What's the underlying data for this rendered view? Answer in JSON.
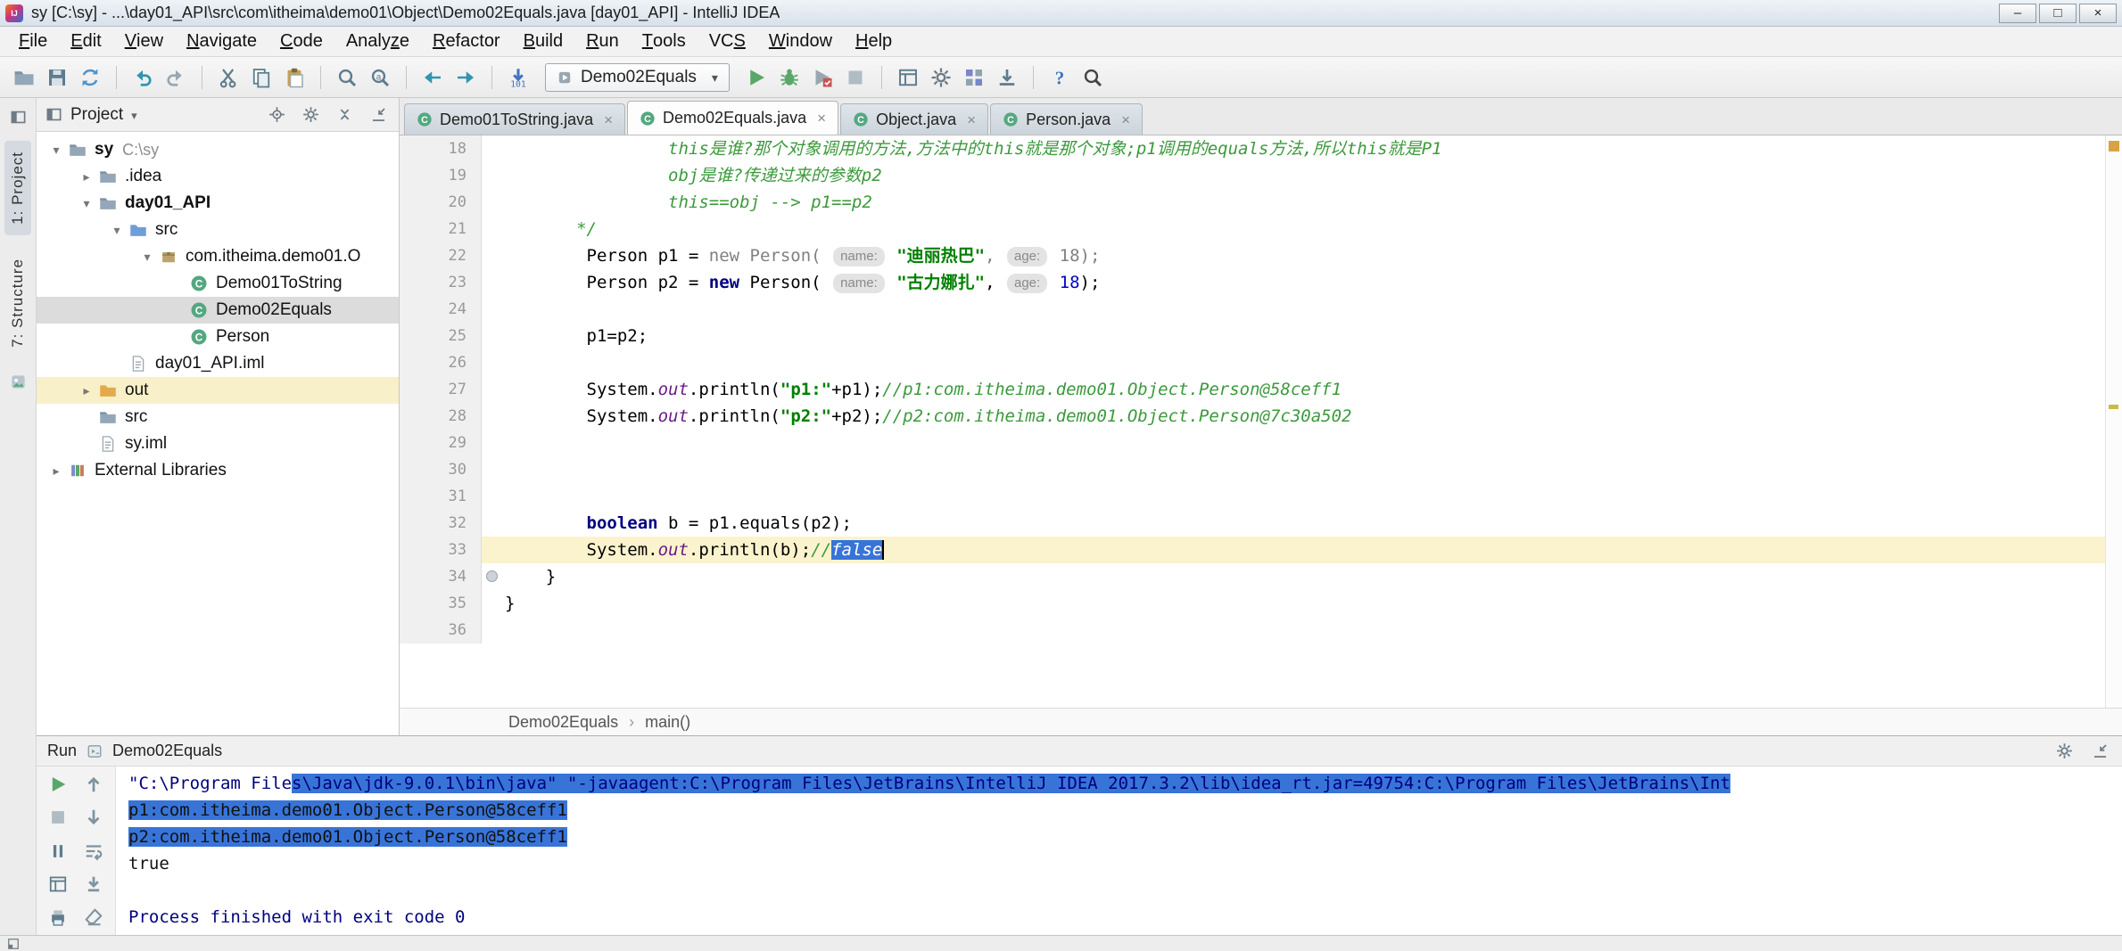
{
  "colors": {
    "sel": "#3874d8",
    "kw": "#000080",
    "str": "#008000",
    "cmt": "#3c9a3c",
    "field": "#6a1b8a",
    "num": "#0000cc",
    "current_line": "#fbf3cd",
    "out_row": "#f8f0c8",
    "run_green": "#59a869",
    "stripe_inspection": "#d9a343",
    "stripe_warning": "#c9b945"
  },
  "window": {
    "logo": "IJ",
    "title": "sy [C:\\sy] - ...\\day01_API\\src\\com\\itheima\\demo01\\Object\\Demo02Equals.java [day01_API] - IntelliJ IDEA",
    "buttons": {
      "minimize": "–",
      "maximize": "□",
      "close": "×"
    }
  },
  "menu_bar": {
    "items": [
      {
        "label": "File",
        "u": 0
      },
      {
        "label": "Edit",
        "u": 0
      },
      {
        "label": "View",
        "u": 0
      },
      {
        "label": "Navigate",
        "u": 0
      },
      {
        "label": "Code",
        "u": 0
      },
      {
        "label": "Analyze",
        "u": 5
      },
      {
        "label": "Refactor",
        "u": 0
      },
      {
        "label": "Build",
        "u": 0
      },
      {
        "label": "Run",
        "u": 0
      },
      {
        "label": "Tools",
        "u": 0
      },
      {
        "label": "VCS",
        "u": 2
      },
      {
        "label": "Window",
        "u": 0
      },
      {
        "label": "Help",
        "u": 0
      }
    ]
  },
  "toolbar": {
    "run_config": "Demo02Equals",
    "items": [
      {
        "icon": "open-folder"
      },
      {
        "icon": "save-all"
      },
      {
        "icon": "synchronize"
      },
      {
        "divider": true
      },
      {
        "icon": "undo"
      },
      {
        "icon": "redo"
      },
      {
        "divider": true
      },
      {
        "icon": "cut"
      },
      {
        "icon": "copy"
      },
      {
        "icon": "paste"
      },
      {
        "divider": true
      },
      {
        "icon": "find"
      },
      {
        "icon": "replace"
      },
      {
        "divider": true
      },
      {
        "icon": "back"
      },
      {
        "icon": "forward"
      },
      {
        "divider": true
      },
      {
        "icon": "update-project"
      },
      {
        "combo": true
      },
      {
        "icon": "run"
      },
      {
        "icon": "debug"
      },
      {
        "icon": "coverage"
      },
      {
        "icon": "stop"
      },
      {
        "divider": true
      },
      {
        "icon": "restore-layout"
      },
      {
        "icon": "settings"
      },
      {
        "icon": "project-structure"
      },
      {
        "icon": "export"
      },
      {
        "divider": true
      },
      {
        "icon": "help"
      },
      {
        "icon": "search-everywhere"
      }
    ]
  },
  "tool_strip": {
    "tabs": [
      {
        "label": "1: Project",
        "active": true
      },
      {
        "label": "7: Structure",
        "active": false
      }
    ]
  },
  "project_panel": {
    "title": "Project",
    "header_icons": [
      "locate",
      "settings",
      "collapse-all",
      "hide-panel"
    ],
    "tree": [
      {
        "label": "sy",
        "suffix": "C:\\sy",
        "icon": "folder",
        "level": 0,
        "chevron": "down",
        "bold": true
      },
      {
        "label": ".idea",
        "icon": "folder",
        "level": 1,
        "chevron": "right"
      },
      {
        "label": "day01_API",
        "icon": "folder",
        "level": 1,
        "chevron": "down",
        "bold": true
      },
      {
        "label": "src",
        "icon": "folder-src",
        "level": 2,
        "chevron": "down"
      },
      {
        "label": "com.itheima.demo01.O",
        "icon": "package",
        "level": 3,
        "chevron": "down"
      },
      {
        "label": "Demo01ToString",
        "icon": "class",
        "level": 4
      },
      {
        "label": "Demo02Equals",
        "icon": "class",
        "level": 4,
        "selected": true
      },
      {
        "label": "Person",
        "icon": "class",
        "level": 4
      },
      {
        "label": "day01_API.iml",
        "icon": "iml",
        "level": 2
      },
      {
        "label": "out",
        "icon": "folder-out",
        "level": 1,
        "chevron": "right",
        "row_highlight": true
      },
      {
        "label": "src",
        "icon": "folder",
        "level": 1
      },
      {
        "label": "sy.iml",
        "icon": "iml",
        "level": 1
      },
      {
        "label": "External Libraries",
        "icon": "library",
        "level": 0,
        "chevron": "right"
      }
    ]
  },
  "editor": {
    "tabs": [
      {
        "label": "Demo01ToString.java",
        "icon": "class"
      },
      {
        "label": "Demo02Equals.java",
        "icon": "class",
        "active": true
      },
      {
        "label": "Object.java",
        "icon": "class"
      },
      {
        "label": "Person.java",
        "icon": "class"
      }
    ],
    "breadcrumbs": [
      "Demo02Equals",
      "main()"
    ],
    "stripe_markers": [
      {
        "name": "inspections-indicator",
        "color": "#d9a343"
      },
      {
        "name": "warning-stripe-mark",
        "color": "#c9b945"
      }
    ],
    "lines": [
      {
        "n": 18,
        "s": [
          [
            "                ",
            "p"
          ],
          [
            "this是谁?那个对象调用的方法,方法中的this就是那个对象;p1调用的equals方法,所以this就是P1",
            "cmt"
          ]
        ]
      },
      {
        "n": 19,
        "s": [
          [
            "                ",
            "p"
          ],
          [
            "obj是谁?传递过来的参数p2",
            "cmt"
          ]
        ]
      },
      {
        "n": 20,
        "s": [
          [
            "                ",
            "p"
          ],
          [
            "this==obj --> p1==p2",
            "cmt"
          ]
        ]
      },
      {
        "n": 21,
        "s": [
          [
            "       ",
            "p"
          ],
          [
            "*/",
            "cmt"
          ]
        ]
      },
      {
        "n": 22,
        "s": [
          [
            "        Person p1 = ",
            "p"
          ],
          [
            "new Person( ",
            "gray"
          ],
          [
            "name:",
            "hint"
          ],
          [
            " ",
            "gray"
          ],
          [
            "\"迪丽热巴\"",
            "str"
          ],
          [
            ", ",
            "gray"
          ],
          [
            "age:",
            "hint"
          ],
          [
            " ",
            "gray"
          ],
          [
            "18",
            "gray"
          ],
          [
            ");",
            "gray"
          ]
        ]
      },
      {
        "n": 23,
        "s": [
          [
            "        Person p2 = ",
            "p"
          ],
          [
            "new",
            "kw"
          ],
          [
            " Person( ",
            "p"
          ],
          [
            "name:",
            "hint"
          ],
          [
            " ",
            "p"
          ],
          [
            "\"古力娜扎\"",
            "str"
          ],
          [
            ", ",
            "p"
          ],
          [
            "age:",
            "hint"
          ],
          [
            " ",
            "p"
          ],
          [
            "18",
            "num"
          ],
          [
            ");",
            "p"
          ]
        ]
      },
      {
        "n": 24,
        "s": []
      },
      {
        "n": 25,
        "s": [
          [
            "        p1=p2;",
            "p"
          ]
        ]
      },
      {
        "n": 26,
        "s": []
      },
      {
        "n": 27,
        "s": [
          [
            "        System.",
            "p"
          ],
          [
            "out",
            "field"
          ],
          [
            ".println(",
            "p"
          ],
          [
            "\"p1:\"",
            "str"
          ],
          [
            "+p1);",
            "p"
          ],
          [
            "//p1:com.itheima.demo01.Object.Person@58ceff1",
            "cmt"
          ]
        ]
      },
      {
        "n": 28,
        "s": [
          [
            "        System.",
            "p"
          ],
          [
            "out",
            "field"
          ],
          [
            ".println(",
            "p"
          ],
          [
            "\"p2:\"",
            "str"
          ],
          [
            "+p2);",
            "p"
          ],
          [
            "//p2:com.itheima.demo01.Object.Person@7c30a502",
            "cmt"
          ]
        ]
      },
      {
        "n": 29,
        "s": []
      },
      {
        "n": 30,
        "s": []
      },
      {
        "n": 31,
        "s": []
      },
      {
        "n": 32,
        "s": [
          [
            "        ",
            "p"
          ],
          [
            "boolean",
            "kw"
          ],
          [
            " b = p1.equals(p2);",
            "p"
          ]
        ]
      },
      {
        "n": 33,
        "cur": true,
        "s": [
          [
            "        System.",
            "p"
          ],
          [
            "out",
            "field"
          ],
          [
            ".println(b);",
            "p"
          ],
          [
            "//",
            "cmt"
          ],
          [
            "false",
            "cmt sel"
          ],
          [
            "",
            "caret"
          ]
        ]
      },
      {
        "n": 34,
        "dot": true,
        "s": [
          [
            "    }",
            "p"
          ]
        ]
      },
      {
        "n": 35,
        "s": [
          [
            "}",
            "p"
          ]
        ]
      },
      {
        "n": 36,
        "s": []
      }
    ]
  },
  "run_panel": {
    "label": "Run",
    "tab": "Demo02Equals",
    "header_icons": [
      "settings",
      "hide-panel"
    ],
    "toolbar_col1": [
      "rerun",
      "stop",
      "pause-output",
      "restore-layout",
      "print"
    ],
    "toolbar_col2": [
      "up-stack",
      "down-stack",
      "soft-wrap",
      "scroll-end",
      "clear-all"
    ],
    "console": [
      {
        "s": [
          [
            "\"C:\\Program File",
            "cmd"
          ],
          [
            "s\\Java\\jdk-9.0.1\\bin\\java\" \"-javaagent:C:\\Program Files\\JetBrains\\IntelliJ IDEA 2017.3.2\\lib\\idea_rt.jar=49754:C:\\Program Files\\JetBrains\\Int",
            "cmd sel"
          ]
        ]
      },
      {
        "s": [
          [
            "p1:com.itheima.demo01.Object.Person@58ceff1",
            "out sel"
          ]
        ]
      },
      {
        "s": [
          [
            "p2:com.itheima.demo01.Object.Person@58ceff1",
            "out sel"
          ]
        ]
      },
      {
        "s": [
          [
            "true",
            "out"
          ]
        ]
      },
      {
        "s": []
      },
      {
        "s": [
          [
            "Process finished with exit code 0",
            "sys"
          ]
        ]
      }
    ]
  }
}
